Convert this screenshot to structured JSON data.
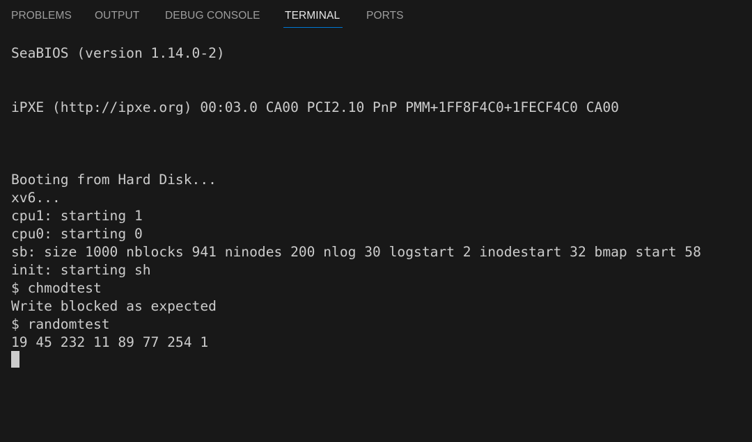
{
  "tabs": {
    "problems": "PROBLEMS",
    "output": "OUTPUT",
    "debug_console": "DEBUG CONSOLE",
    "terminal": "TERMINAL",
    "ports": "PORTS",
    "active": "TERMINAL"
  },
  "terminal": {
    "lines": [
      "SeaBIOS (version 1.14.0-2)",
      "iPXE (http://ipxe.org) 00:03.0 CA00 PCI2.10 PnP PMM+1FF8F4C0+1FECF4C0 CA00",
      "Booting from Hard Disk...",
      "xv6...",
      "cpu1: starting 1",
      "cpu0: starting 0",
      "sb: size 1000 nblocks 941 ninodes 200 nlog 30 logstart 2 inodestart 32 bmap start 58",
      "init: starting sh",
      "$ chmodtest",
      "Write blocked as expected",
      "$ randomtest",
      "19 45 232 11 89 77 254 1"
    ]
  },
  "colors": {
    "background": "#181818",
    "text": "#cccccc",
    "tab_inactive": "#9d9d9d",
    "tab_active": "#e7e7e7",
    "accent": "#0078d4"
  }
}
